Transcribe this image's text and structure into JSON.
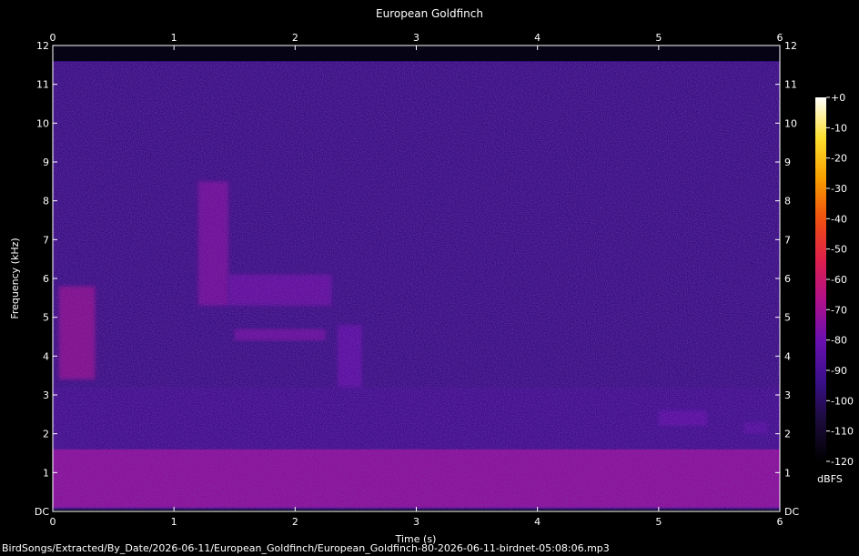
{
  "chart_data": {
    "type": "heatmap",
    "title": "European Goldfinch",
    "xlabel": "Time (s)",
    "ylabel": "Frequency (kHz)",
    "xlim": [
      0,
      6
    ],
    "ylim": [
      0,
      12
    ],
    "x_ticks": [
      0,
      1,
      2,
      3,
      4,
      5,
      6
    ],
    "x_tick_labels": [
      "0",
      "1",
      "2",
      "3",
      "4",
      "5",
      "6"
    ],
    "y_ticks": [
      0,
      1,
      2,
      3,
      4,
      5,
      6,
      7,
      8,
      9,
      10,
      11,
      12
    ],
    "y_tick_labels": [
      "DC",
      "1",
      "2",
      "3",
      "4",
      "5",
      "6",
      "7",
      "8",
      "9",
      "10",
      "11",
      "12"
    ],
    "colorbar": {
      "label": "dBFS",
      "range": [
        -120,
        0
      ],
      "tick_values": [
        0,
        -10,
        -20,
        -30,
        -40,
        -50,
        -60,
        -70,
        -80,
        -90,
        -100,
        -110,
        -120
      ],
      "tick_labels": [
        "+0",
        "-10",
        "-20",
        "-30",
        "-40",
        "-50",
        "-60",
        "-70",
        "-80",
        "-90",
        "-100",
        "-110",
        "-120"
      ],
      "colormap": [
        "#000000",
        "#1a0b3a",
        "#3a0f8a",
        "#6a10b0",
        "#b0108a",
        "#e0204a",
        "#f05010",
        "#f8a000",
        "#fde030",
        "#ffffff"
      ]
    },
    "background_level_dbfs": -95,
    "energy_bands": [
      {
        "t_start": 0.0,
        "t_end": 6.0,
        "f_low": 0.1,
        "f_high": 1.6,
        "level_dbfs": -72
      },
      {
        "t_start": 0.0,
        "t_end": 6.0,
        "f_low": 1.6,
        "f_high": 3.2,
        "level_dbfs": -90
      }
    ],
    "call_features": [
      {
        "t_start": 0.05,
        "t_end": 0.35,
        "f_low": 3.4,
        "f_high": 5.8,
        "level_dbfs": -68
      },
      {
        "t_start": 1.2,
        "t_end": 1.45,
        "f_low": 5.3,
        "f_high": 8.5,
        "level_dbfs": -74
      },
      {
        "t_start": 1.45,
        "t_end": 2.3,
        "f_low": 5.3,
        "f_high": 6.1,
        "level_dbfs": -78
      },
      {
        "t_start": 1.5,
        "t_end": 2.25,
        "f_low": 4.4,
        "f_high": 4.7,
        "level_dbfs": -76
      },
      {
        "t_start": 2.35,
        "t_end": 2.55,
        "f_low": 3.2,
        "f_high": 4.8,
        "level_dbfs": -80
      },
      {
        "t_start": 5.0,
        "t_end": 5.4,
        "f_low": 2.2,
        "f_high": 2.6,
        "level_dbfs": -82
      },
      {
        "t_start": 5.7,
        "t_end": 5.9,
        "f_low": 2.0,
        "f_high": 2.3,
        "level_dbfs": -84
      }
    ]
  },
  "footer": {
    "file_path": "BirdSongs/Extracted/By_Date/2026-06-11/European_Goldfinch/European_Goldfinch-80-2026-06-11-birdnet-05:08:06.mp3"
  }
}
